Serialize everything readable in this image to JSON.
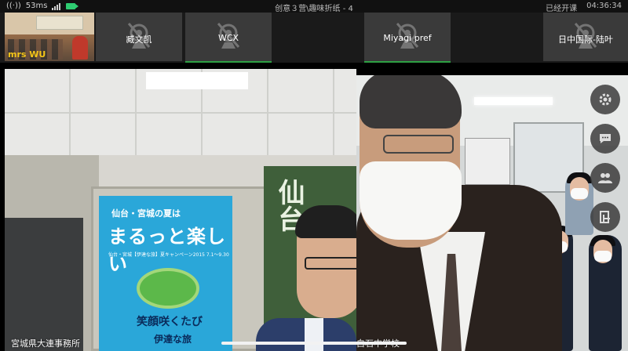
{
  "status_bar": {
    "latency": "53ms",
    "meeting_title": "创意３营\\趣味折纸 - 4",
    "class_status": "已经开课",
    "clock": "04:36:34"
  },
  "participants": [
    {
      "name": "mrs WU",
      "camera": "on"
    },
    {
      "name": "臧文凯",
      "camera": "off"
    },
    {
      "name": "WCX",
      "camera": "off"
    },
    {
      "name": "Miyagi pref",
      "camera": "off"
    },
    {
      "name": "日中国际-陆叶",
      "camera": "off"
    }
  ],
  "main_videos": {
    "left_label": "宮城県大連事務所",
    "right_label": "白石中学校"
  },
  "poster": {
    "line1": "仙台・宮城の夏は",
    "line2": "まるっと楽しい",
    "line3": "仙台・宮城【伊達な旅】夏キャンペーン2015 7.1〜9.30",
    "line4": "笑顔咲くたび",
    "line5": "伊達な旅",
    "side_text": "仙台"
  },
  "side_controls": [
    {
      "icon": "gear-icon"
    },
    {
      "icon": "chat-icon"
    },
    {
      "icon": "participants-icon"
    },
    {
      "icon": "share-icon"
    }
  ],
  "colors": {
    "active_underline": "#2ea043",
    "host_name": "#f5c518",
    "camera_status": "#2ecc71"
  }
}
